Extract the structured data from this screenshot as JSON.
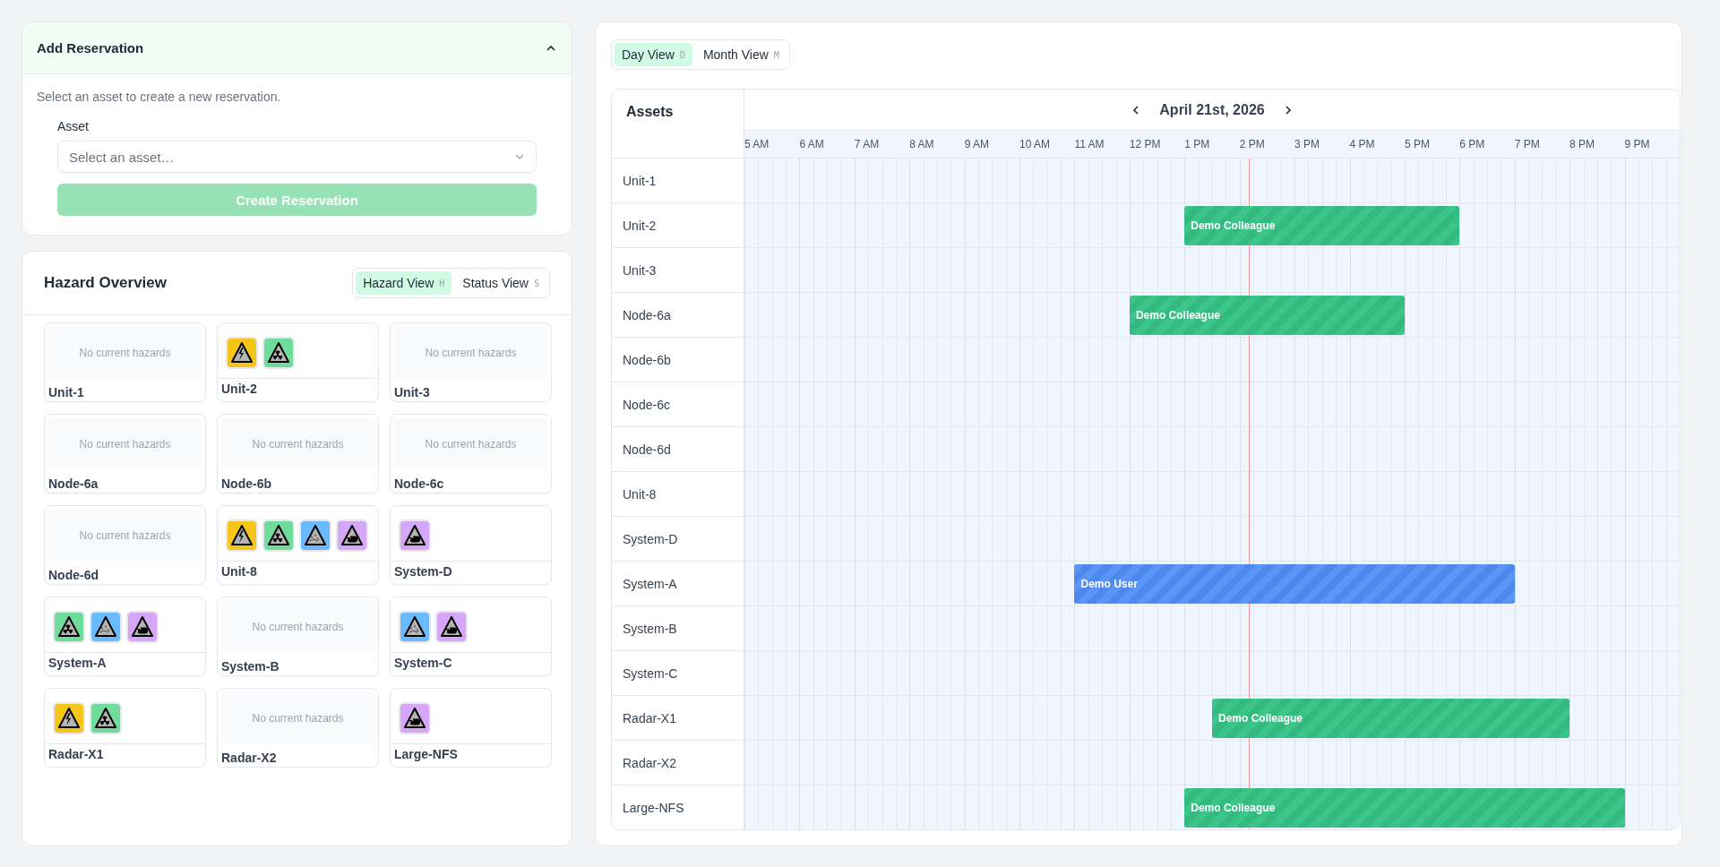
{
  "reservation": {
    "title": "Add Reservation",
    "expanded": true,
    "description": "Select an asset to create a new reservation.",
    "asset_label": "Asset",
    "asset_placeholder": "Select an asset…",
    "create_button": {
      "label": "Create Reservation",
      "disabled": true
    }
  },
  "hazard_overview": {
    "title": "Hazard Overview",
    "views": [
      {
        "label": "Hazard View",
        "shortcut": "H",
        "selected": true
      },
      {
        "label": "Status View",
        "shortcut": "S",
        "selected": false
      }
    ],
    "assets": [
      {
        "name": "Unit-1",
        "note": "No current hazards"
      },
      {
        "name": "Unit-2",
        "hazards": [
          {
            "kind": "electrical"
          },
          {
            "kind": "radiation"
          }
        ]
      },
      {
        "name": "Unit-3",
        "note": "No current hazards"
      },
      {
        "name": "Node-6a",
        "note": "No current hazards"
      },
      {
        "name": "Node-6b",
        "note": "No current hazards"
      },
      {
        "name": "Node-6c",
        "note": "No current hazards"
      },
      {
        "name": "Node-6d",
        "note": "No current hazards"
      },
      {
        "name": "Unit-8",
        "hazards": [
          {
            "kind": "electrical"
          },
          {
            "kind": "radiation"
          },
          {
            "kind": "chemical"
          },
          {
            "kind": "hand"
          }
        ]
      },
      {
        "name": "System-D",
        "hazards": [
          {
            "kind": "hand"
          }
        ]
      },
      {
        "name": "System-A",
        "hazards": [
          {
            "kind": "radiation"
          },
          {
            "kind": "chemical"
          },
          {
            "kind": "hand"
          }
        ]
      },
      {
        "name": "System-B",
        "note": "No current hazards"
      },
      {
        "name": "System-C",
        "hazards": [
          {
            "kind": "chemical"
          },
          {
            "kind": "hand"
          }
        ]
      },
      {
        "name": "Radar-X1",
        "hazards": [
          {
            "kind": "electrical"
          },
          {
            "kind": "radiation"
          }
        ]
      },
      {
        "name": "Radar-X2",
        "note": "No current hazards"
      },
      {
        "name": "Large-NFS",
        "hazards": [
          {
            "kind": "hand"
          }
        ]
      }
    ]
  },
  "schedule": {
    "views": [
      {
        "label": "Day View",
        "shortcut": "D",
        "selected": true
      },
      {
        "label": "Month View",
        "shortcut": "M",
        "selected": false
      }
    ],
    "assets_heading": "Assets",
    "date": "April 21st, 2026",
    "hours": [
      "5 AM",
      "6 AM",
      "7 AM",
      "8 AM",
      "9 AM",
      "10 AM",
      "11 AM",
      "12 PM",
      "1 PM",
      "2 PM",
      "3 PM",
      "4 PM",
      "5 PM",
      "6 PM",
      "7 PM",
      "8 PM",
      "9 PM"
    ],
    "rows": [
      {
        "asset": "Unit-1"
      },
      {
        "asset": "Unit-2",
        "reservations": [
          {
            "label": "Demo Colleague",
            "kind": "colleague"
          }
        ]
      },
      {
        "asset": "Unit-3"
      },
      {
        "asset": "Node-6a",
        "reservations": [
          {
            "label": "Demo Colleague",
            "kind": "colleague"
          }
        ]
      },
      {
        "asset": "Node-6b"
      },
      {
        "asset": "Node-6c"
      },
      {
        "asset": "Node-6d"
      },
      {
        "asset": "Unit-8"
      },
      {
        "asset": "System-D"
      },
      {
        "asset": "System-A",
        "reservations": [
          {
            "label": "Demo User",
            "kind": "own"
          }
        ]
      },
      {
        "asset": "System-B"
      },
      {
        "asset": "System-C"
      },
      {
        "asset": "Radar-X1",
        "reservations": [
          {
            "label": "Demo Colleague",
            "kind": "colleague"
          }
        ]
      },
      {
        "asset": "Radar-X2"
      },
      {
        "asset": "Large-NFS",
        "reservations": [
          {
            "label": "Demo Colleague",
            "kind": "colleague"
          }
        ]
      }
    ]
  }
}
